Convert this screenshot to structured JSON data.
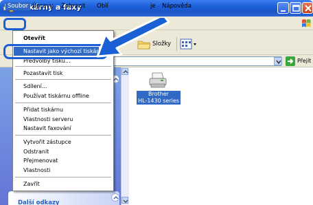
{
  "window": {
    "title": "Tiskárny a faxy"
  },
  "menubar": {
    "items": [
      "Soubor",
      "Úpravy",
      "Zobrazit",
      "Oblí",
      "je",
      "Nápověda"
    ]
  },
  "toolbar": {
    "folders_label": "Složky"
  },
  "addressbar": {
    "go_label": "Přejít"
  },
  "file_menu": {
    "items": [
      "Otevřít",
      "Nastavit jako výchozí tiskárnu",
      "Předvolby tisku...",
      "Pozastavit tisk",
      "Sdílení...",
      "Používat tiskárnu offline",
      "Přidat tiskárnu",
      "Vlastnosti serveru",
      "Nastavit faxování",
      "Vytvořit zástupce",
      "Odstranit",
      "Přejmenovat",
      "Vlastnosti",
      "Zavřít"
    ],
    "selected": "Nastavit jako výchozí tiskárnu"
  },
  "main": {
    "printers": [
      {
        "name_line1": "Brother",
        "name_line2": "HL-1430 series"
      }
    ]
  },
  "taskpane": {
    "other_links_title": "Další odkazy"
  },
  "colors": {
    "titlebar": "#1c5fd8",
    "selection": "#316ac5",
    "highlight_ring": "#1a5fd4",
    "taskpane": "#6f8bdf"
  }
}
